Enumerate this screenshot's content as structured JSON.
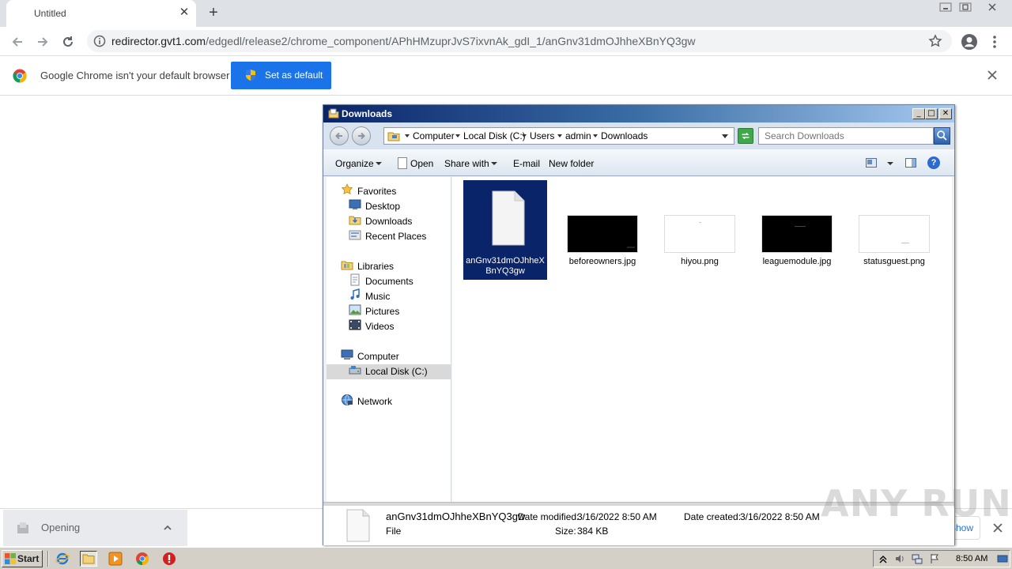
{
  "browser": {
    "tab_title": "Untitled",
    "url_host": "redirector.gvt1.com",
    "url_path": "/edgedl/release2/chrome_component/APhHMzuprJvS7ixvnAk_gdI_1/anGnv31dmOJhheXBnYQ3gw",
    "infobar_text": "Google Chrome isn't your default browser",
    "set_default_label": "Set as default"
  },
  "download_bar": {
    "item_status": "Opening",
    "show_all_label": "Show all"
  },
  "explorer": {
    "title": "Downloads",
    "breadcrumbs": [
      "Computer",
      "Local Disk (C:)",
      "Users",
      "admin",
      "Downloads"
    ],
    "search_placeholder": "Search Downloads",
    "commands": {
      "organize": "Organize",
      "open": "Open",
      "share_with": "Share with",
      "email": "E-mail",
      "new_folder": "New folder"
    },
    "nav": {
      "favorites": "Favorites",
      "desktop": "Desktop",
      "downloads": "Downloads",
      "recent_places": "Recent Places",
      "libraries": "Libraries",
      "documents": "Documents",
      "music": "Music",
      "pictures": "Pictures",
      "videos": "Videos",
      "computer": "Computer",
      "local_disk": "Local Disk (C:)",
      "network": "Network"
    },
    "files": [
      {
        "name": "anGnv31dmOJhheXBnYQ3gw",
        "type": "document",
        "selected": true
      },
      {
        "name": "beforeowners.jpg",
        "type": "image-dark",
        "selected": false
      },
      {
        "name": "hiyou.png",
        "type": "image-light",
        "selected": false
      },
      {
        "name": "leaguemodule.jpg",
        "type": "image-dark",
        "selected": false
      },
      {
        "name": "statusguest.png",
        "type": "image-light",
        "selected": false
      }
    ],
    "details": {
      "name": "anGnv31dmOJhheXBnYQ3gw",
      "type": "File",
      "modified_label": "Date modified:",
      "modified_value": "3/16/2022 8:50 AM",
      "size_label": "Size:",
      "size_value": "384 KB",
      "created_label": "Date created:",
      "created_value": "3/16/2022 8:50 AM"
    }
  },
  "taskbar": {
    "start_label": "Start",
    "clock": "8:50 AM"
  },
  "watermark": "ANY RUN",
  "colors": {
    "chrome_blue": "#1a73e8",
    "title_gradient_start": "#0a246a",
    "selection": "#0a246a"
  }
}
